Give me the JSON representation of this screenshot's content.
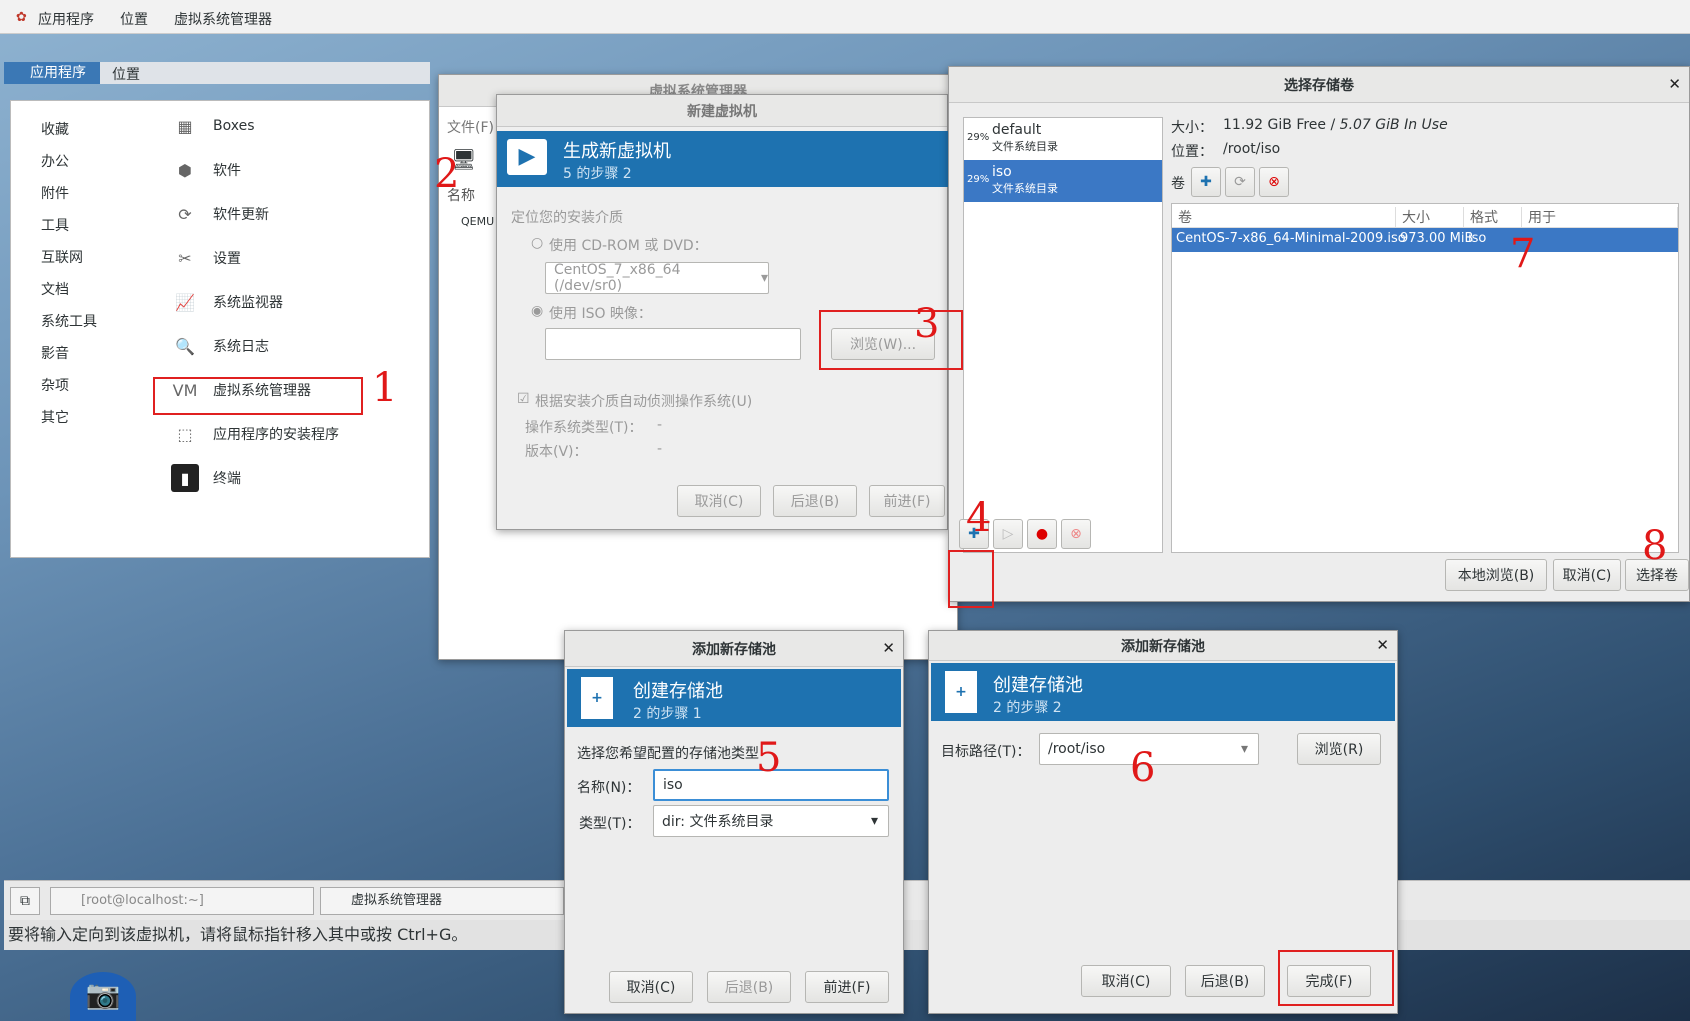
{
  "topbar": {
    "apps": "应用程序",
    "places": "位置",
    "vmm": "虚拟系统管理器"
  },
  "appmenu": {
    "tab_apps": "应用程序",
    "tab_places": "位置",
    "categories": [
      "收藏",
      "办公",
      "附件",
      "工具",
      "互联网",
      "文档",
      "系统工具",
      "影音",
      "杂项",
      "其它"
    ],
    "apps": [
      "Boxes",
      "软件",
      "软件更新",
      "设置",
      "系统监视器",
      "系统日志",
      "虚拟系统管理器",
      "应用程序的安装程序",
      "终端"
    ]
  },
  "vmm_window": {
    "title": "虚拟系统管理器",
    "menu_file": "文件(F)",
    "col_name": "名称",
    "row_qemu": "QEMU"
  },
  "new_vm": {
    "title": "新建虚拟机",
    "heading": "生成新虚拟机",
    "step": "5 的步骤 2",
    "locate": "定位您的安装介质",
    "use_cdrom": "使用 CD-ROM 或 DVD：",
    "cdrom_value": "CentOS_7_x86_64 (/dev/sr0)",
    "use_iso": "使用 ISO 映像：",
    "browse": "浏览(W)...",
    "auto_detect": "根据安装介质自动侦测操作系统(U)",
    "os_type": "操作系统类型(T)：",
    "os_type_val": "-",
    "version": "版本(V)：",
    "version_val": "-",
    "cancel": "取消(C)",
    "back": "后退(B)",
    "forward": "前进(F)"
  },
  "storage": {
    "title": "选择存储卷",
    "pools": [
      {
        "pct": "29%",
        "name": "default",
        "type": "文件系统目录"
      },
      {
        "pct": "29%",
        "name": "iso",
        "type": "文件系统目录"
      }
    ],
    "size_label": "大小：",
    "size_free": "11.92 GiB Free",
    "size_sep": " / ",
    "size_use": "5.07 GiB In Use",
    "loc_label": "位置：",
    "loc_value": "/root/iso",
    "vol_label": "卷",
    "columns": [
      "卷",
      "大小",
      "格式",
      "用于"
    ],
    "rows": [
      {
        "name": "CentOS-7-x86_64-Minimal-2009.iso",
        "size": "973.00 MiB",
        "format": "iso",
        "used": ""
      }
    ],
    "local_browse": "本地浏览(B)",
    "cancel": "取消(C)",
    "choose": "选择卷"
  },
  "pool1": {
    "title": "添加新存储池",
    "heading": "创建存储池",
    "step": "2 的步骤 1",
    "prompt": "选择您希望配置的存储池类型",
    "name_label": "名称(N)：",
    "name_value": "iso",
    "type_label": "类型(T)：",
    "type_value": "dir: 文件系统目录",
    "cancel": "取消(C)",
    "back": "后退(B)",
    "forward": "前进(F)"
  },
  "pool2": {
    "title": "添加新存储池",
    "heading": "创建存储池",
    "step": "2 的步骤 2",
    "target_label": "目标路径(T)：",
    "target_value": "/root/iso",
    "browse": "浏览(R)",
    "cancel": "取消(C)",
    "back": "后退(B)",
    "finish": "完成(F)"
  },
  "taskbar": {
    "terminal": "[root@localhost:~]",
    "vmm": "虚拟系统管理器"
  },
  "statusbar": "要将输入定向到该虚拟机，请将鼠标指针移入其中或按 Ctrl+G。",
  "annotations": [
    "1",
    "2",
    "3",
    "4",
    "5",
    "6",
    "7",
    "8"
  ]
}
